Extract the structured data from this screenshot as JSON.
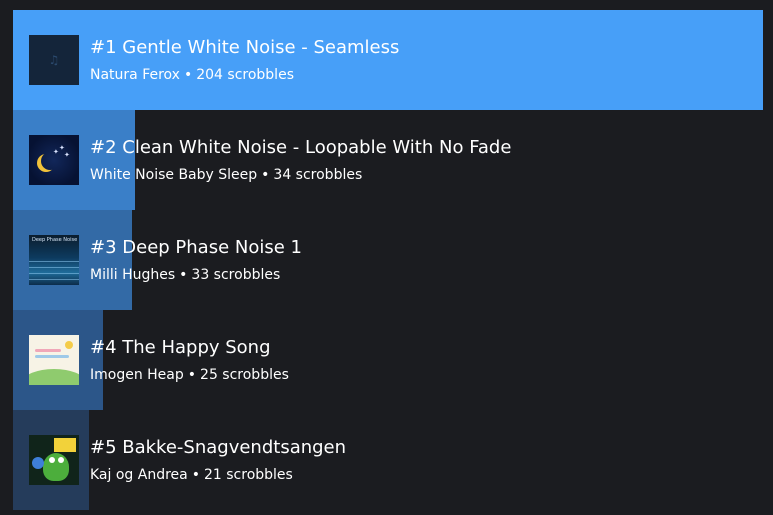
{
  "colors": {
    "background": "#1b1c20",
    "bar_1": "#479ff8",
    "bar_2": "#3a7fc8",
    "bar_3": "#336aa6",
    "bar_4": "#2c5689",
    "bar_5": "#253c5b"
  },
  "tracks": [
    {
      "title": "#1 Gentle White Noise - Seamless",
      "artist": "Natura Ferox",
      "separator": "•",
      "scrobbles": "204 scrobbles",
      "scrobble_count": 204,
      "bar_fraction": 1.0
    },
    {
      "title": "#2 Clean White Noise - Loopable With No Fade",
      "artist": "White Noise Baby Sleep",
      "separator": "•",
      "scrobbles": "34 scrobbles",
      "scrobble_count": 34,
      "bar_fraction": 0.163
    },
    {
      "title": "#3 Deep Phase Noise 1",
      "artist": "Milli Hughes",
      "separator": "•",
      "scrobbles": "33 scrobbles",
      "scrobble_count": 33,
      "bar_fraction": 0.158,
      "art_caption": "Deep Phase Noise"
    },
    {
      "title": "#4 The Happy Song",
      "artist": "Imogen Heap",
      "separator": "•",
      "scrobbles": "25 scrobbles",
      "scrobble_count": 25,
      "bar_fraction": 0.12
    },
    {
      "title": "#5 Bakke-Snagvendtsangen",
      "artist": "Kaj og Andrea",
      "separator": "•",
      "scrobbles": "21 scrobbles",
      "scrobble_count": 21,
      "bar_fraction": 0.101
    }
  ],
  "icons": {
    "art_1": "music-note-icon",
    "art_2": "moon-stars-icon",
    "art_3": "ocean-waves-icon",
    "art_4": "happy-landscape-icon",
    "art_5": "cartoon-creature-icon"
  }
}
